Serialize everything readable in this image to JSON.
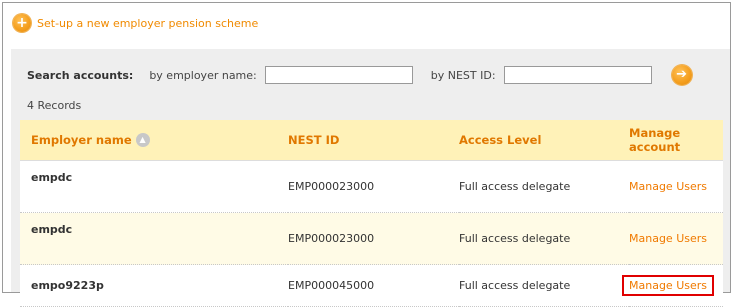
{
  "actions": {
    "new_scheme_label": "Set-up a new employer pension scheme",
    "plus_glyph": "+"
  },
  "search": {
    "title": "Search accounts:",
    "by_employer_label": "by employer name:",
    "employer_value": "",
    "by_nest_label": "by NEST ID:",
    "nest_value": "",
    "go_glyph": "➔"
  },
  "records_text": "4 Records",
  "table": {
    "headers": {
      "employer_name": "Employer name",
      "nest_id": "NEST ID",
      "access_level": "Access Level",
      "manage_account": "Manage account"
    },
    "sort_glyph": "▲",
    "rows": [
      {
        "employer": "empdc",
        "nest_id": "EMP000023000",
        "access": "Full access delegate",
        "action": "Manage Users"
      },
      {
        "employer": "empdc",
        "nest_id": "EMP000023000",
        "access": "Full access delegate",
        "action": "Manage Users"
      },
      {
        "employer": "empo9223p",
        "nest_id": "EMP000045000",
        "access": "Full access delegate",
        "action": "Manage Users"
      }
    ]
  },
  "colors": {
    "accent_orange": "#f07a00",
    "header_bg": "#fff2b8",
    "panel_bg": "#eeeeee",
    "highlight_red": "#e00000"
  }
}
